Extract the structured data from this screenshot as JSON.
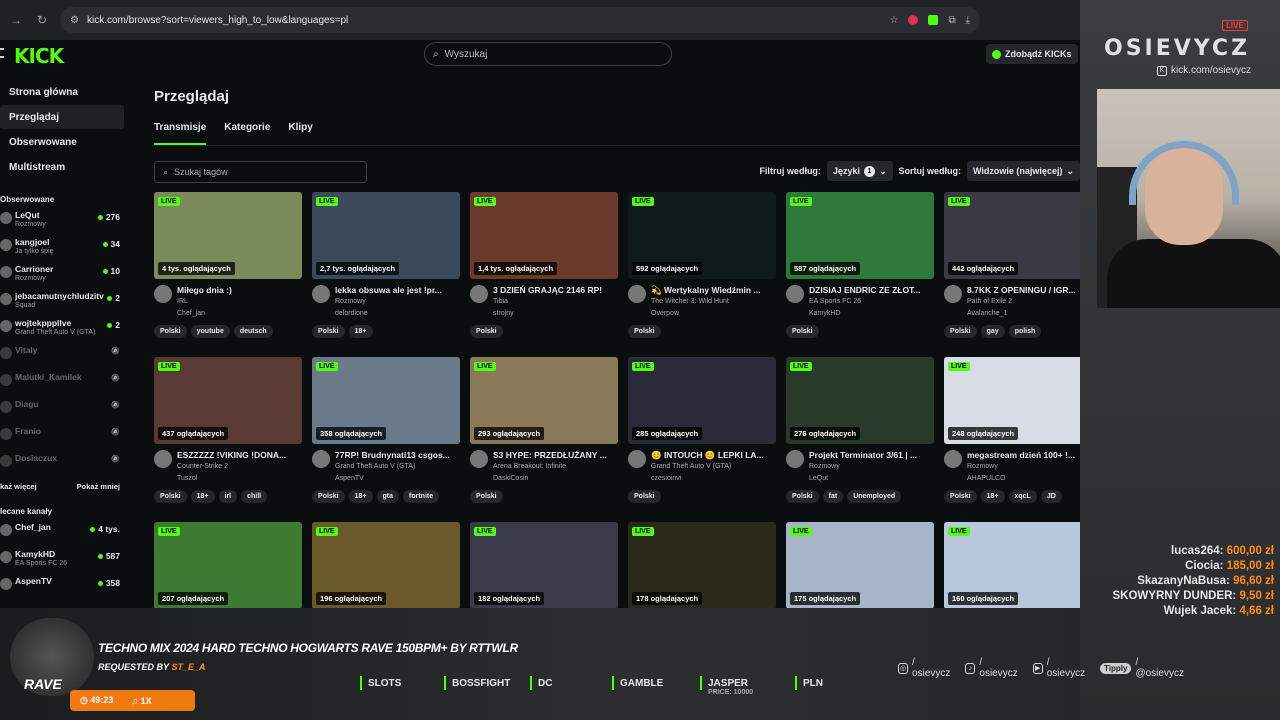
{
  "browser": {
    "url": "kick.com/browse?sort=viewers_high_to_low&languages=pl"
  },
  "header": {
    "logo": "KICK",
    "search_placeholder": "Wyszukaj",
    "kicks_button": "Zdobądź KICKs"
  },
  "sidebar": {
    "nav": [
      "Strona główna",
      "Przeglądaj",
      "Obserwowane",
      "Multistream"
    ],
    "following_title": "Obserwowane",
    "following": [
      {
        "name": "LeQut",
        "sub": "Rozmowy",
        "count": "276",
        "online": true
      },
      {
        "name": "kangjoel",
        "sub": "Ja tylko śpię",
        "count": "34",
        "online": true
      },
      {
        "name": "Carrioner",
        "sub": "Rozmowy",
        "count": "10",
        "online": true
      },
      {
        "name": "jebacamutnychludzitv",
        "sub": "Squad",
        "count": "2",
        "online": true
      },
      {
        "name": "wojtekpppllve",
        "sub": "Grand Theft Auto V (GTA)",
        "count": "2",
        "online": true
      },
      {
        "name": "Vitaly",
        "sub": "",
        "count": "",
        "online": false
      },
      {
        "name": "Malutki_Kamilek",
        "sub": "",
        "count": "",
        "online": false
      },
      {
        "name": "Diagu",
        "sub": "",
        "count": "",
        "online": false
      },
      {
        "name": "Franio",
        "sub": "",
        "count": "",
        "online": false
      },
      {
        "name": "Dosiaczux",
        "sub": "",
        "count": "",
        "online": false
      }
    ],
    "show_more": "każ więcej",
    "show_less": "Pokaż mniej",
    "recommended_title": "lecane kanały",
    "recommended": [
      {
        "name": "Chef_jan",
        "sub": "",
        "count": "4 tys."
      },
      {
        "name": "KamykHD",
        "sub": "EA Sports FC 26",
        "count": "587"
      },
      {
        "name": "AspenTV",
        "sub": "",
        "count": "358"
      }
    ]
  },
  "main": {
    "title": "Przeglądaj",
    "tabs": [
      "Transmisje",
      "Kategorie",
      "Klipy"
    ],
    "tag_search_placeholder": "Szukaj tagów",
    "filter_label": "Filtruj według:",
    "languages_label": "Języki",
    "languages_count": "1",
    "sort_label": "Sortuj według:",
    "sort_value": "Widzowie (najwięcej)",
    "live_label": "LIVE"
  },
  "streams": [
    {
      "viewers": "4 tys. oglądających",
      "title": "Miłego dnia :)",
      "category": "IRL",
      "channel": "Chef_jan",
      "tags": [
        "Polski",
        "youtube",
        "deutsch"
      ],
      "color": "#7a8a5a"
    },
    {
      "viewers": "2,7 tys. oglądających",
      "title": "lekka obsuwa ale jest !pr...",
      "category": "Rozmowy",
      "channel": "delordione",
      "tags": [
        "Polski",
        "18+"
      ],
      "color": "#3b4a5a"
    },
    {
      "viewers": "1,4 tys. oglądających",
      "title": "3 DZIEŃ GRAJĄC 2146 RP!",
      "category": "Tibia",
      "channel": "strojny",
      "tags": [
        "Polski"
      ],
      "color": "#6a3b2a"
    },
    {
      "viewers": "592 oglądających",
      "title": "💫 Wertykalny Wiedźmin ...",
      "category": "The Witcher 3: Wild Hunt",
      "channel": "Overpow",
      "tags": [
        "Polski"
      ],
      "color": "#0f1a1a"
    },
    {
      "viewers": "587 oglądających",
      "title": "DZISIAJ ENDRIC ZE ZŁOT...",
      "category": "EA Sports FC 26",
      "channel": "KamykHD",
      "tags": [
        "Polski"
      ],
      "color": "#2f7a3a"
    },
    {
      "viewers": "442 oglądających",
      "title": "8.7KK Z OPENINGU / IGR...",
      "category": "Path of Exile 2",
      "channel": "Avalanche_1",
      "tags": [
        "Polski",
        "gay",
        "polish"
      ],
      "color": "#3a3a44"
    },
    {
      "viewers": "437 oglądających",
      "title": "ESZZZZZ !VIKING !DONA...",
      "category": "Counter-Strike 2",
      "channel": "Tuszol",
      "tags": [
        "Polski",
        "18+",
        "irl",
        "chill"
      ],
      "color": "#5a3a34"
    },
    {
      "viewers": "358 oglądających",
      "title": "77RP! Brudnynati13 csgos...",
      "category": "Grand Theft Auto V (GTA)",
      "channel": "AspenTV",
      "tags": [
        "Polski",
        "18+",
        "gta",
        "fortnite"
      ],
      "color": "#6a7a8a"
    },
    {
      "viewers": "293 oglądających",
      "title": "S3 HYPE: PRZEDŁUŻANY ...",
      "category": "Arena Breakout: Infinite",
      "channel": "DaskiCosin",
      "tags": [
        "Polski"
      ],
      "color": "#8a7a5a"
    },
    {
      "viewers": "285 oglądających",
      "title": "😊 INTOUCH 😊 LEPKI LA...",
      "category": "Grand Theft Auto V (GTA)",
      "channel": "czesioinvi",
      "tags": [
        "Polski"
      ],
      "color": "#2a2a3a"
    },
    {
      "viewers": "276 oglądających",
      "title": "Projekt Terminator 3/61 | ...",
      "category": "Rozmowy",
      "channel": "LeQut",
      "tags": [
        "Polski",
        "fat",
        "Unemployed"
      ],
      "color": "#2a3a2a"
    },
    {
      "viewers": "248 oglądających",
      "title": "megastream dzień 100+ !...",
      "category": "Rozmowy",
      "channel": "AHAPULCO",
      "tags": [
        "Polski",
        "18+",
        "xqcL",
        "JD"
      ],
      "color": "#d8dce4"
    },
    {
      "viewers": "207 oglądających",
      "title": "",
      "category": "",
      "channel": "",
      "tags": [],
      "color": "#3f7a32"
    },
    {
      "viewers": "196 oglądających",
      "title": "",
      "category": "",
      "channel": "",
      "tags": [],
      "color": "#6a5a2a"
    },
    {
      "viewers": "182 oglądających",
      "title": "",
      "category": "",
      "channel": "",
      "tags": [],
      "color": "#3a3a4a"
    },
    {
      "viewers": "178 oglądających",
      "title": "",
      "category": "",
      "channel": "",
      "tags": [],
      "color": "#2a2a1a"
    },
    {
      "viewers": "175 oglądających",
      "title": "",
      "category": "",
      "channel": "",
      "tags": [],
      "color": "#a8b4c8"
    },
    {
      "viewers": "160 oglądających",
      "title": "",
      "category": "",
      "channel": "",
      "tags": [],
      "color": "#b8c8dc"
    }
  ],
  "overlay": {
    "brand": "OSIEVYCZ",
    "live_badge": "LIVE",
    "kick_url": "kick.com/osievycz",
    "donations": [
      {
        "name": "lucas264:",
        "amount": "600,00 zł"
      },
      {
        "name": "Ciocia:",
        "amount": "185,00 zł"
      },
      {
        "name": "SkazanyNaBusa:",
        "amount": "96,60 zł"
      },
      {
        "name": "SKOWYRNY DUNDER:",
        "amount": "9,50 zł"
      },
      {
        "name": "Wujek Jacek:",
        "amount": "4,66 zł"
      }
    ],
    "song_title": "TECHNO MIX 2024 HARD TECHNO HOGWARTS RAVE 150BPM+ BY RTTWLR",
    "requested_by_label": "REQUESTED BY",
    "requested_by": "ST_E_A",
    "rave_label": "RAVE",
    "timer": "49:23",
    "multiplier": "1X",
    "commands": [
      {
        "label": "SLOTS",
        "sub": ""
      },
      {
        "label": "BOSSFIGHT",
        "sub": ""
      },
      {
        "label": "DC",
        "sub": ""
      },
      {
        "label": "GAMBLE",
        "sub": ""
      },
      {
        "label": "JASPER",
        "sub": "PRICE: 10000"
      },
      {
        "label": "PLN",
        "sub": ""
      }
    ],
    "socials": [
      {
        "icon": "instagram-icon",
        "handle": "/ osievycz"
      },
      {
        "icon": "tiktok-icon",
        "handle": "/ osievycz"
      },
      {
        "icon": "youtube-icon",
        "handle": "/ osievycz"
      },
      {
        "icon": "tipply-icon",
        "handle": "/ @osievycz"
      }
    ],
    "tipply_label": "Tipply"
  },
  "colors": {
    "accent": "#53fc18",
    "donation": "#ff8c1a",
    "live_red": "#ff3838"
  }
}
